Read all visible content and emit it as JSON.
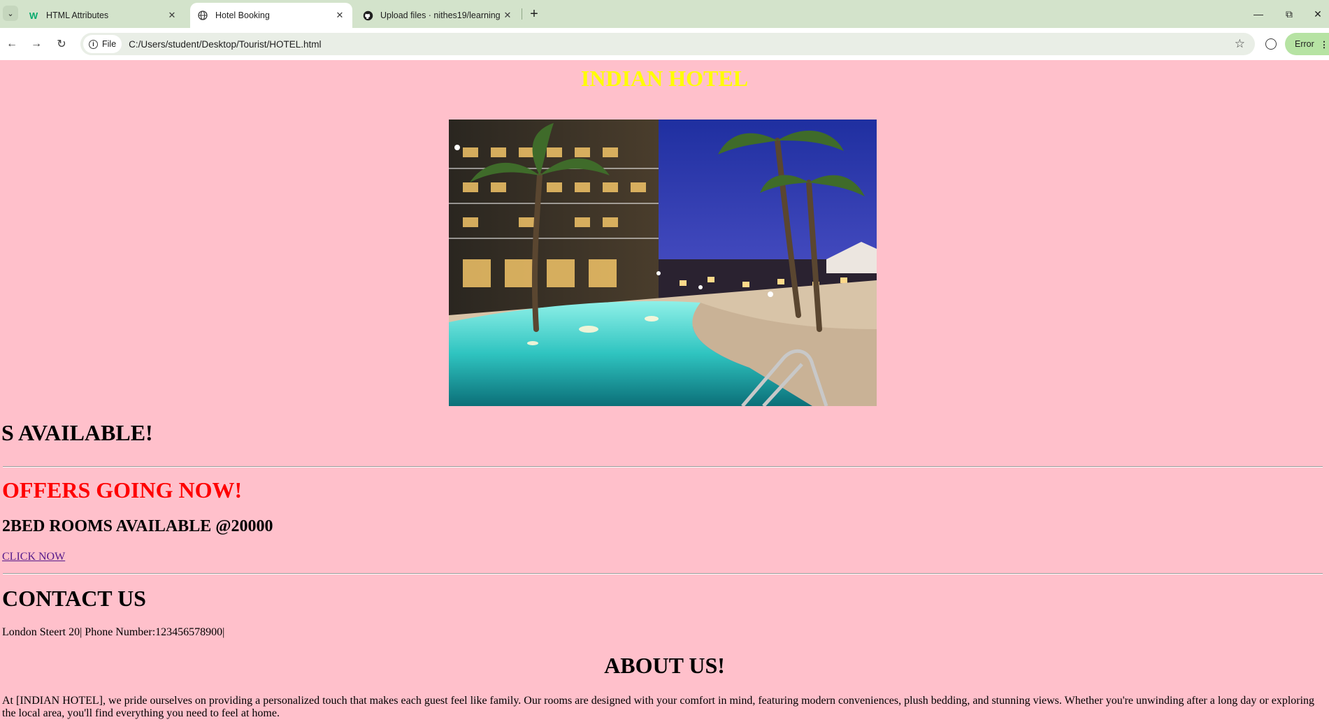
{
  "browser": {
    "tabs": [
      {
        "title": "HTML Attributes",
        "icon": "w3schools-icon",
        "active": false
      },
      {
        "title": "Hotel Booking",
        "icon": "globe-icon",
        "active": true
      },
      {
        "title": "Upload files · nithes19/learning",
        "icon": "github-icon",
        "active": false
      }
    ],
    "address_chip": "File",
    "url": "C:/Users/student/Desktop/Tourist/HOTEL.html",
    "error_button": "Error",
    "accent_color": "#d3e3cb"
  },
  "page": {
    "hotel_title": "INDIAN HOTEL",
    "image_alt": "Hotel pool at night with palm trees",
    "marquee_text": "S AVAILABLE!",
    "offers_heading": "OFFERS GOING NOW!",
    "rooms_heading": "2BED ROOMS AVAILABLE @20000",
    "click_link": "CLICK NOW",
    "contact_heading": "CONTACT US",
    "address_line": "London Steert 20| Phone Number:123456578900|",
    "about_heading": "ABOUT US!",
    "about_text": "At [INDIAN HOTEL], we pride ourselves on providing a personalized touch that makes each guest feel like family. Our rooms are designed with your comfort in mind, featuring modern conveniences, plush bedding, and stunning views. Whether you're unwinding after a long day or exploring the local area, you'll find everything you need to feel at home.",
    "background_color": "#ffc0cb",
    "title_color": "#ffff00",
    "offers_color": "#ff0000"
  }
}
